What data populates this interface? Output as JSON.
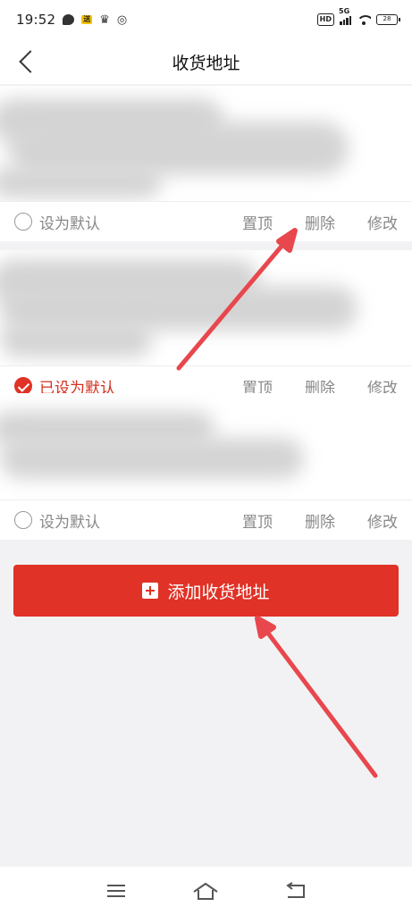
{
  "status_bar": {
    "time": "19:52",
    "badge": "送",
    "hd": "HD",
    "network": "5G",
    "battery": "28"
  },
  "header": {
    "title": "收货地址"
  },
  "addresses": [
    {
      "default_label": "设为默认",
      "is_default": false,
      "actions": [
        "置顶",
        "删除",
        "修改"
      ]
    },
    {
      "default_label": "已设为默认",
      "is_default": true,
      "actions": [
        "置顶",
        "删除",
        "修改"
      ]
    },
    {
      "default_label": "设为默认",
      "is_default": false,
      "actions": [
        "置顶",
        "删除",
        "修改"
      ]
    }
  ],
  "add_button": {
    "label": "添加收货地址"
  },
  "colors": {
    "accent": "#e03226",
    "annotation_arrow": "#e8474d"
  },
  "icons": {
    "back": "chevron-left-icon",
    "add": "plus-square-icon",
    "menu": "menu-icon",
    "home": "home-icon",
    "back_nav": "return-icon"
  }
}
